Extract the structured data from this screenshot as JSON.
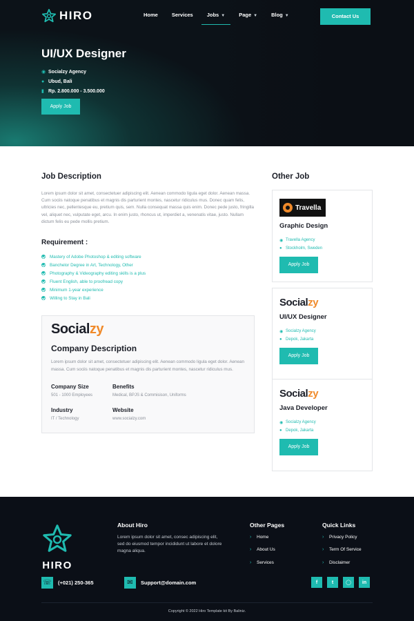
{
  "brand": {
    "name": "HIRO"
  },
  "nav": {
    "items": [
      {
        "label": "Home",
        "dropdown": false
      },
      {
        "label": "Services",
        "dropdown": false
      },
      {
        "label": "Jobs",
        "dropdown": true,
        "active": true
      },
      {
        "label": "Page",
        "dropdown": true
      },
      {
        "label": "Blog",
        "dropdown": true
      }
    ],
    "contact_label": "Contact Us"
  },
  "hero": {
    "title": "UI/UX Designer",
    "company": "Socialzy Agency",
    "location": "Ubud, Bali",
    "salary": "Rp. 2.800.000 - 3.500.000",
    "apply_label": "Apply Job"
  },
  "job_description": {
    "title": "Job Description",
    "text": "Lorem ipsum dolor sit amet, consectetuer adipiscing elit. Aenean commodo ligula eget dolor. Aenean massa. Cum sociis natoque penatibus et magnis dis parturient montes, nascetur ridiculus mus. Donec quam felis, ultricies nec, pellentesque eu, pretium quis, sem. Nulla consequat massa quis enim. Donec pede justo, fringilla vel, aliquet nec, vulputate eget, arcu. In enim justo, rhoncus ut, imperdiet a, venenatis vitae, justo. Nullam dictum felis eu pede mollis pretium."
  },
  "requirement": {
    "title": "Requirement :",
    "items": [
      "Mastery of Adobe Photoshop & editing software",
      "Banchelor Degree in Art, Technology, Other",
      "Photography & Videography editing skills is a plus",
      "Fluent English, able to proofread copy",
      "Minimum 1-year experience",
      "Willing to Stay in Bali"
    ]
  },
  "company": {
    "brand_main": "Social",
    "brand_accent": "zy",
    "title": "Company Description",
    "text": "Lorem ipsum dolor sit amet, consectetuer adipiscing elit. Aenean commodo ligula eget dolor. Aenean massa. Cum sociis natoque penatibus et magnis dis parturient montes, nascetur ridiculus mus.",
    "size_label": "Company Size",
    "size_value": "501 - 1000 Employees",
    "benefits_label": "Benefits",
    "benefits_value": "Medical, BPJS & Commisison, Uniforms",
    "industry_label": "Industry",
    "industry_value": "IT / Technology",
    "website_label": "Website",
    "website_value": "www.socialzy.com"
  },
  "other_jobs": {
    "title": "Other Job",
    "apply_label": "Apply Job",
    "cards": [
      {
        "logo_text": "Travella",
        "title": "Graphic Design",
        "company": "Travella Agency",
        "location": "Stockholm, Sweden"
      },
      {
        "logo_main": "Social",
        "logo_accent": "zy",
        "title": "UI/UX Designer",
        "company": "Socialzy Agency",
        "location": "Depok, Jakarta"
      },
      {
        "logo_main": "Social",
        "logo_accent": "zy",
        "title": "Java Developer",
        "company": "Socialzy Agency",
        "location": "Depok, Jakarta"
      }
    ]
  },
  "footer": {
    "logo_text": "HIRO",
    "about_title": "About Hiro",
    "about_text": "Lorem ipsum dolor sit amet, consec adipiscing elit, sed do eiusmod tempor incididunt ut labore et dolore magna aliqua.",
    "other_pages_title": "Other Pages",
    "other_pages": [
      "Home",
      "About Us",
      "Services"
    ],
    "quick_links_title": "Quick Links",
    "quick_links": [
      "Privacy Policy",
      "Term Of Service",
      "Disclaimer"
    ],
    "phone": "(+021) 250-365",
    "email": "Support@domain.com",
    "socials": [
      "facebook-icon",
      "twitter-icon",
      "instagram-icon",
      "linkedin-icon"
    ],
    "copyright": "Copyright © 2022 Hiro Template kit By Baliniz."
  },
  "colors": {
    "accent": "#1fbbb0",
    "dark": "#0b0f17",
    "brand_orange": "#f08a2a"
  }
}
